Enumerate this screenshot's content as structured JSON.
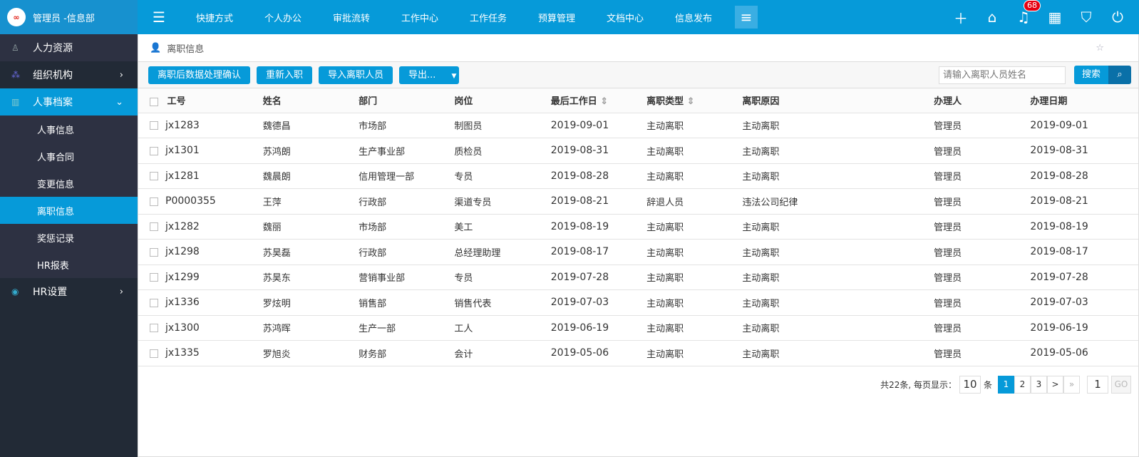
{
  "user": {
    "name": "管理员 -信息部",
    "logo_text": "∞"
  },
  "sidebar": {
    "items": [
      {
        "label": "人力资源",
        "icon": "person-list-icon"
      },
      {
        "label": "组织机构",
        "icon": "org-icon"
      },
      {
        "label": "人事档案",
        "icon": "archive-icon"
      }
    ],
    "sub": [
      "人事信息",
      "人事合同",
      "变更信息",
      "离职信息",
      "奖惩记录",
      "HR报表"
    ],
    "hr_settings": "HR设置"
  },
  "nav": [
    "快捷方式",
    "个人办公",
    "审批流转",
    "工作中心",
    "工作任务",
    "预算管理",
    "文档中心",
    "信息发布"
  ],
  "notifications": "68",
  "breadcrumb": "离职信息",
  "toolbar": {
    "buttons": [
      "离职后数据处理确认",
      "重新入职",
      "导入离职人员",
      "导出..."
    ],
    "search_placeholder": "请输入离职人员姓名",
    "search_label": "搜索"
  },
  "table": {
    "headers": [
      "工号",
      "姓名",
      "部门",
      "岗位",
      "最后工作日",
      "离职类型",
      "离职原因",
      "办理人",
      "办理日期"
    ],
    "rows": [
      [
        "jx1283",
        "魏德昌",
        "市场部",
        "制图员",
        "2019-09-01",
        "主动离职",
        "主动离职",
        "管理员",
        "2019-09-01"
      ],
      [
        "jx1301",
        "苏鸿朗",
        "生产事业部",
        "质检员",
        "2019-08-31",
        "主动离职",
        "主动离职",
        "管理员",
        "2019-08-31"
      ],
      [
        "jx1281",
        "魏晨朗",
        "信用管理一部",
        "专员",
        "2019-08-28",
        "主动离职",
        "主动离职",
        "管理员",
        "2019-08-28"
      ],
      [
        "P0000355",
        "王萍",
        "行政部",
        "渠道专员",
        "2019-08-21",
        "辞退人员",
        "违法公司纪律",
        "管理员",
        "2019-08-21"
      ],
      [
        "jx1282",
        "魏丽",
        "市场部",
        "美工",
        "2019-08-19",
        "主动离职",
        "主动离职",
        "管理员",
        "2019-08-19"
      ],
      [
        "jx1298",
        "苏昊磊",
        "行政部",
        "总经理助理",
        "2019-08-17",
        "主动离职",
        "主动离职",
        "管理员",
        "2019-08-17"
      ],
      [
        "jx1299",
        "苏昊东",
        "营销事业部",
        "专员",
        "2019-07-28",
        "主动离职",
        "主动离职",
        "管理员",
        "2019-07-28"
      ],
      [
        "jx1336",
        "罗炫明",
        "销售部",
        "销售代表",
        "2019-07-03",
        "主动离职",
        "主动离职",
        "管理员",
        "2019-07-03"
      ],
      [
        "jx1300",
        "苏鸿晖",
        "生产一部",
        "工人",
        "2019-06-19",
        "主动离职",
        "主动离职",
        "管理员",
        "2019-06-19"
      ],
      [
        "jx1335",
        "罗旭炎",
        "财务部",
        "会计",
        "2019-05-06",
        "主动离职",
        "主动离职",
        "管理员",
        "2019-05-06"
      ]
    ]
  },
  "pager": {
    "total": "共22条, 每页显示：",
    "page_size": "10",
    "unit": "条",
    "pages": [
      "1",
      "2",
      "3"
    ],
    "next": ">",
    "last": "»",
    "goto": "1",
    "go": "GO"
  }
}
